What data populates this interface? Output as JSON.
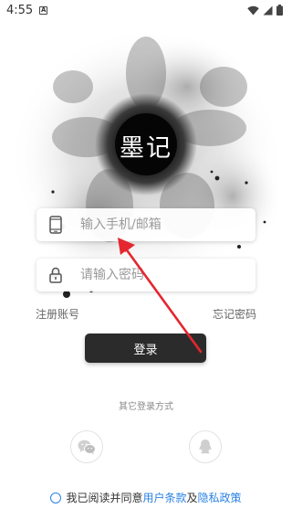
{
  "status_bar": {
    "time": "4:55",
    "notification_glyph": "A"
  },
  "app": {
    "logo_text": "墨记"
  },
  "form": {
    "phone_placeholder": "输入手机/邮箱",
    "password_placeholder": "请输入密码",
    "register_label": "注册账号",
    "forgot_label": "忘记密码",
    "login_label": "登录"
  },
  "other_login": {
    "label": "其它登录方式",
    "icons": [
      "wechat-icon",
      "qq-icon"
    ]
  },
  "agreement": {
    "prefix": "我已阅读并同意",
    "terms": "用户条款",
    "joiner": "及",
    "privacy": "隐私政策"
  },
  "colors": {
    "accent_blue": "#2a82e4",
    "button_dark": "#2b2b2b",
    "annotation_red": "#e5262f"
  }
}
